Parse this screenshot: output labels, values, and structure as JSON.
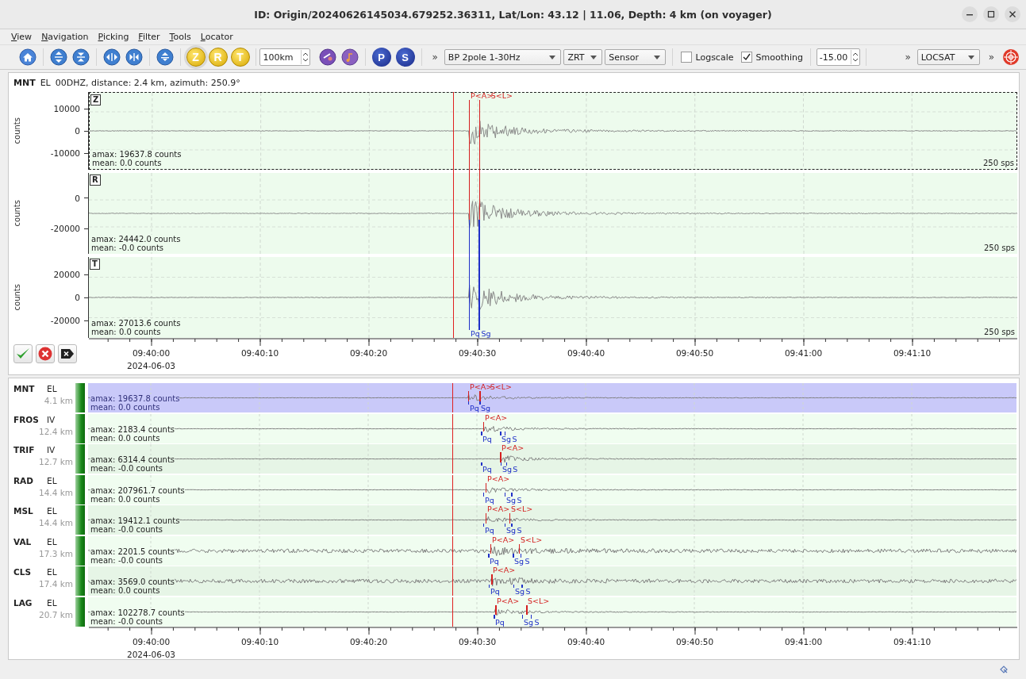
{
  "window": {
    "title": "ID: Origin/20240626145034.679252.36311, Lat/Lon: 43.12 | 11.06, Depth: 4 km (on voyager)"
  },
  "menu": [
    "View",
    "Navigation",
    "Picking",
    "Filter",
    "Tools",
    "Locator"
  ],
  "toolbar": {
    "components": [
      {
        "label": "Z",
        "selected": true
      },
      {
        "label": "R",
        "selected": false
      },
      {
        "label": "T",
        "selected": false
      }
    ],
    "distance": "100km",
    "phases": [
      "P",
      "S"
    ],
    "overflow_marks": [
      "»",
      "»",
      "»"
    ],
    "filter": "BP 2pole 1-30Hz",
    "rotation": "ZRT",
    "unit": "Sensor",
    "logscale": {
      "label": "Logscale",
      "checked": false
    },
    "smoothing": {
      "label": "Smoothing",
      "checked": true
    },
    "value": "-15.00",
    "locator": "LOCSAT"
  },
  "detail": {
    "station": "MNT",
    "network": "EL",
    "info": "00DHZ, distance: 2.4 km, azimuth: 250.9°",
    "origin_marker": {
      "level": 0.3923
    },
    "traces": [
      {
        "component": "Z",
        "selected": true,
        "axis_label": "counts",
        "ticks": [
          "10000",
          "0",
          "-10000"
        ],
        "amax": "amax: 19637.8 counts",
        "mean": "mean: 0.0 counts",
        "rate": "250 sps"
      },
      {
        "component": "R",
        "selected": false,
        "axis_label": "counts",
        "ticks": [
          "0",
          "-20000"
        ],
        "amax": "amax: 24442.0 counts",
        "mean": "mean: -0.0 counts",
        "rate": "250 sps"
      },
      {
        "component": "T",
        "selected": false,
        "axis_label": "counts",
        "ticks": [
          "20000",
          "0",
          "-20000"
        ],
        "amax": "amax: 27013.6 counts",
        "mean": "mean: 0.0 counts",
        "rate": "250 sps"
      }
    ],
    "picks": [
      {
        "label": "P<A>",
        "kind": "manual",
        "level": 0.4094
      },
      {
        "label": "S<L>",
        "kind": "manual",
        "level": 0.4205
      },
      {
        "label": "Pq",
        "kind": "predicted",
        "level": 0.4094
      },
      {
        "label": "Sg",
        "kind": "predicted",
        "level": 0.4197
      }
    ],
    "time_ticks": [
      "09:40:00",
      "09:40:10",
      "09:40:20",
      "09:40:30",
      "09:40:40",
      "09:40:50",
      "09:41:00",
      "09:41:10"
    ],
    "date": "2024-06-03"
  },
  "stations": [
    {
      "code": "MNT",
      "network": "EL",
      "distance": "4.1 km",
      "selected": true,
      "noisy": false,
      "amax": "amax: 19637.8 counts",
      "mean": "mean: 0.0 counts",
      "picks": [
        {
          "label": "P<A>",
          "kind": "manual",
          "level": 0.4094
        },
        {
          "label": "S<L>",
          "kind": "manual",
          "level": 0.4214
        },
        {
          "label": "Pq",
          "kind": "predicted",
          "level": 0.4094
        },
        {
          "label": "Sg",
          "kind": "predicted",
          "level": 0.4214
        }
      ]
    },
    {
      "code": "FROS",
      "network": "IV",
      "distance": "12.4 km",
      "selected": false,
      "noisy": false,
      "amax": "amax: 2183.4 counts",
      "mean": "mean: 0.0 counts",
      "picks": [
        {
          "label": "P<A>",
          "kind": "manual",
          "level": 0.4256
        },
        {
          "label": "Pq",
          "kind": "predicted",
          "level": 0.4231
        },
        {
          "label": "Sg",
          "kind": "predicted",
          "level": 0.4436
        },
        {
          "label": "S",
          "kind": "predicted",
          "level": 0.4487
        }
      ]
    },
    {
      "code": "TRIF",
      "network": "IV",
      "distance": "12.7 km",
      "selected": false,
      "noisy": false,
      "amax": "amax: 6314.4 counts",
      "mean": "mean: -0.0 counts",
      "picks": [
        {
          "label": "P<A>",
          "kind": "manual",
          "level": 0.4436
        },
        {
          "label": "Pq",
          "kind": "predicted",
          "level": 0.4231
        },
        {
          "label": "Sg",
          "kind": "predicted",
          "level": 0.4444
        },
        {
          "label": "S",
          "kind": "predicted",
          "level": 0.4504
        }
      ]
    },
    {
      "code": "RAD",
      "network": "EL",
      "distance": "14.4 km",
      "selected": false,
      "noisy": false,
      "amax": "amax: 207961.7 counts",
      "mean": "mean: 0.0 counts",
      "picks": [
        {
          "label": "P<A>",
          "kind": "manual",
          "level": 0.4282
        },
        {
          "label": "Pq",
          "kind": "predicted",
          "level": 0.4256
        },
        {
          "label": "Sg",
          "kind": "predicted",
          "level": 0.4487
        },
        {
          "label": "S",
          "kind": "predicted",
          "level": 0.4556
        }
      ]
    },
    {
      "code": "MSL",
      "network": "EL",
      "distance": "14.4 km",
      "selected": false,
      "noisy": false,
      "amax": "amax: 19412.1 counts",
      "mean": "mean: -0.0 counts",
      "picks": [
        {
          "label": "P<A>",
          "kind": "manual",
          "level": 0.4282
        },
        {
          "label": "S<L>",
          "kind": "manual",
          "level": 0.4538
        },
        {
          "label": "Pq",
          "kind": "predicted",
          "level": 0.4256
        },
        {
          "label": "Sg",
          "kind": "predicted",
          "level": 0.4487
        },
        {
          "label": "S",
          "kind": "predicted",
          "level": 0.4556
        }
      ]
    },
    {
      "code": "VAL",
      "network": "EL",
      "distance": "17.3 km",
      "selected": false,
      "noisy": true,
      "amax": "amax: 2201.5 counts",
      "mean": "mean: -0.0 counts",
      "picks": [
        {
          "label": "P<A>",
          "kind": "manual",
          "level": 0.4333
        },
        {
          "label": "S<L>",
          "kind": "manual",
          "level": 0.4641
        },
        {
          "label": "Pq",
          "kind": "predicted",
          "level": 0.4308
        },
        {
          "label": "Sg",
          "kind": "predicted",
          "level": 0.4573
        },
        {
          "label": "S",
          "kind": "predicted",
          "level": 0.4658
        }
      ]
    },
    {
      "code": "CLS",
      "network": "EL",
      "distance": "17.4 km",
      "selected": false,
      "noisy": true,
      "amax": "amax: 3569.0 counts",
      "mean": "mean: 0.0 counts",
      "picks": [
        {
          "label": "P<A>",
          "kind": "manual",
          "level": 0.4342
        },
        {
          "label": "Pq",
          "kind": "predicted",
          "level": 0.4316
        },
        {
          "label": "Sg",
          "kind": "predicted",
          "level": 0.4581
        },
        {
          "label": "S",
          "kind": "predicted",
          "level": 0.4667
        }
      ]
    },
    {
      "code": "LAG",
      "network": "EL",
      "distance": "20.7 km",
      "selected": false,
      "noisy": false,
      "amax": "amax: 102278.7 counts",
      "mean": "mean: -0.0 counts",
      "picks": [
        {
          "label": "P<A>",
          "kind": "manual",
          "level": 0.4385
        },
        {
          "label": "S<L>",
          "kind": "manual",
          "level": 0.4718
        },
        {
          "label": "Pq",
          "kind": "predicted",
          "level": 0.4368
        },
        {
          "label": "Sg",
          "kind": "predicted",
          "level": 0.4675
        },
        {
          "label": "S",
          "kind": "predicted",
          "level": 0.4769
        }
      ]
    }
  ],
  "overview_axis": {
    "time_ticks": [
      "09:40:00",
      "09:40:10",
      "09:40:20",
      "09:40:30",
      "09:40:40",
      "09:40:50",
      "09:41:00",
      "09:41:10"
    ],
    "date": "2024-06-03"
  }
}
